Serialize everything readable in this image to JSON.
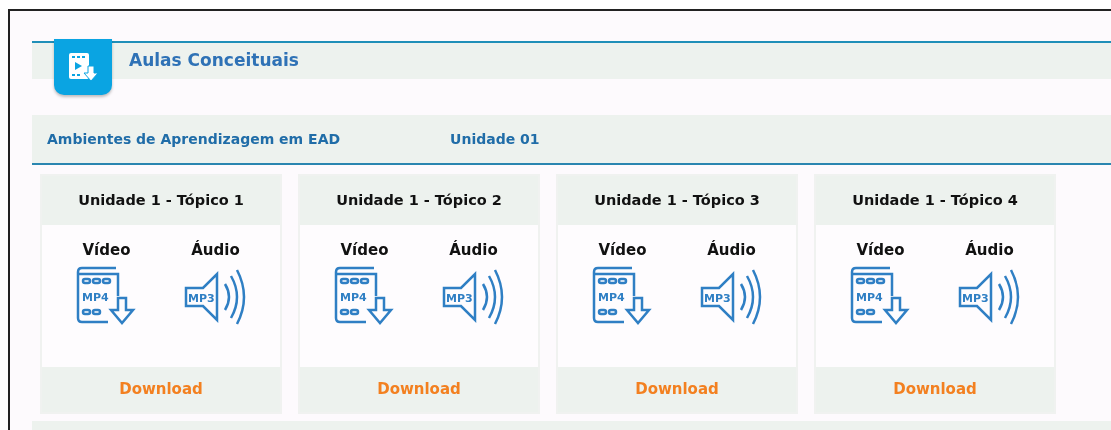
{
  "section": {
    "title": "Aulas Conceituais"
  },
  "course": {
    "name": "Ambientes de Aprendizagem em EAD",
    "unit": "Unidade 01"
  },
  "topics": [
    {
      "title": "Unidade 1 - Tópico 1",
      "video_label": "Vídeo",
      "video_format": "MP4",
      "audio_label": "Áudio",
      "audio_format": "MP3",
      "link": "Download"
    },
    {
      "title": "Unidade 1 - Tópico 2",
      "video_label": "Vídeo",
      "video_format": "MP4",
      "audio_label": "Áudio",
      "audio_format": "MP3",
      "link": "Download"
    },
    {
      "title": "Unidade 1 - Tópico 3",
      "video_label": "Vídeo",
      "video_format": "MP4",
      "audio_label": "Áudio",
      "audio_format": "MP3",
      "link": "Download"
    },
    {
      "title": "Unidade 1 - Tópico 4",
      "video_label": "Vídeo",
      "video_format": "MP4",
      "audio_label": "Áudio",
      "audio_format": "MP3",
      "link": "Download"
    }
  ]
}
